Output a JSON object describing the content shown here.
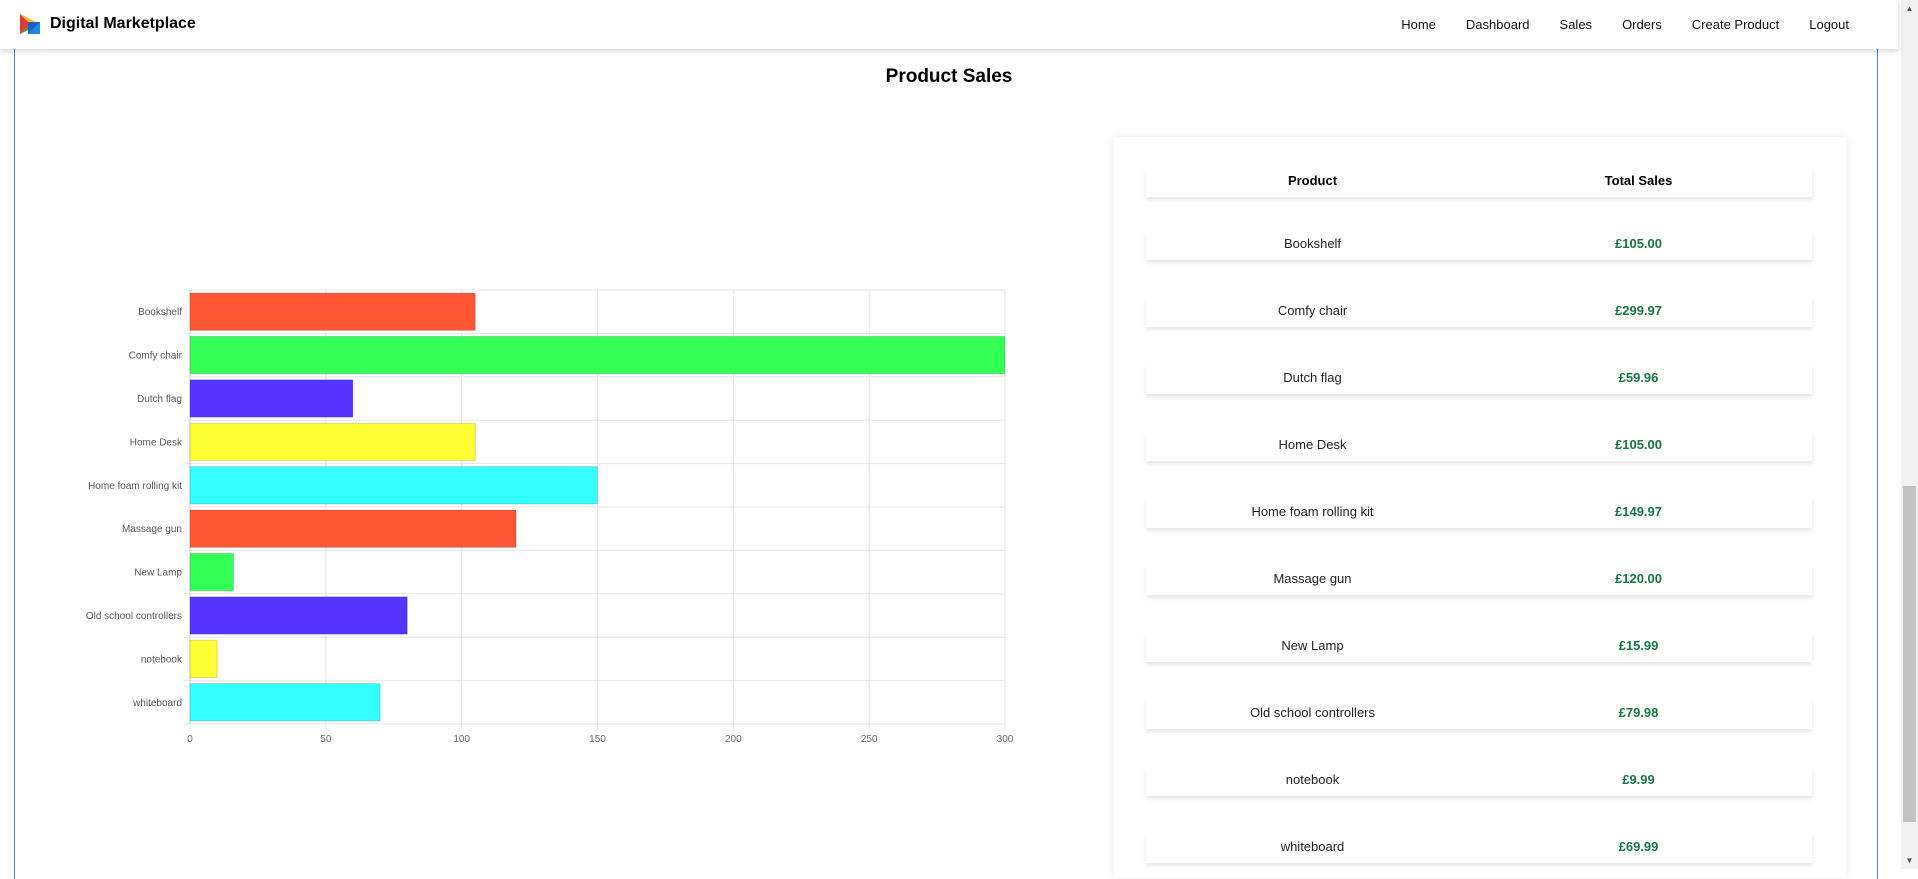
{
  "navbar": {
    "brand": "Digital Marketplace",
    "links": [
      "Home",
      "Dashboard",
      "Sales",
      "Orders",
      "Create Product",
      "Logout"
    ]
  },
  "page": {
    "title": "Product Sales"
  },
  "table": {
    "headers": {
      "product": "Product",
      "total": "Total Sales"
    },
    "rows": [
      {
        "product": "Bookshelf",
        "total": "£105.00"
      },
      {
        "product": "Comfy chair",
        "total": "£299.97"
      },
      {
        "product": "Dutch flag",
        "total": "£59.96"
      },
      {
        "product": "Home Desk",
        "total": "£105.00"
      },
      {
        "product": "Home foam rolling kit",
        "total": "£149.97"
      },
      {
        "product": "Massage gun",
        "total": "£120.00"
      },
      {
        "product": "New Lamp",
        "total": "£15.99"
      },
      {
        "product": "Old school controllers",
        "total": "£79.98"
      },
      {
        "product": "notebook",
        "total": "£9.99"
      },
      {
        "product": "whiteboard",
        "total": "£69.99"
      }
    ]
  },
  "colors": {
    "bars": [
      "#ff5733",
      "#33ff57",
      "#5733ff",
      "#ffff33",
      "#33ffff"
    ],
    "total_text": "#157347",
    "frame_border": "#4f7fe6"
  },
  "chart_data": {
    "type": "bar",
    "orientation": "horizontal",
    "categories": [
      "Bookshelf",
      "Comfy chair",
      "Dutch flag",
      "Home Desk",
      "Home foam rolling kit",
      "Massage gun",
      "New Lamp",
      "Old school controllers",
      "notebook",
      "whiteboard"
    ],
    "values": [
      105.0,
      299.97,
      59.96,
      105.0,
      149.97,
      120.0,
      15.99,
      79.98,
      9.99,
      69.99
    ],
    "xticks": [
      "0",
      "50",
      "100",
      "150",
      "200",
      "250",
      "300"
    ],
    "xlim": [
      0,
      300
    ],
    "grid": true,
    "legend": "none"
  }
}
